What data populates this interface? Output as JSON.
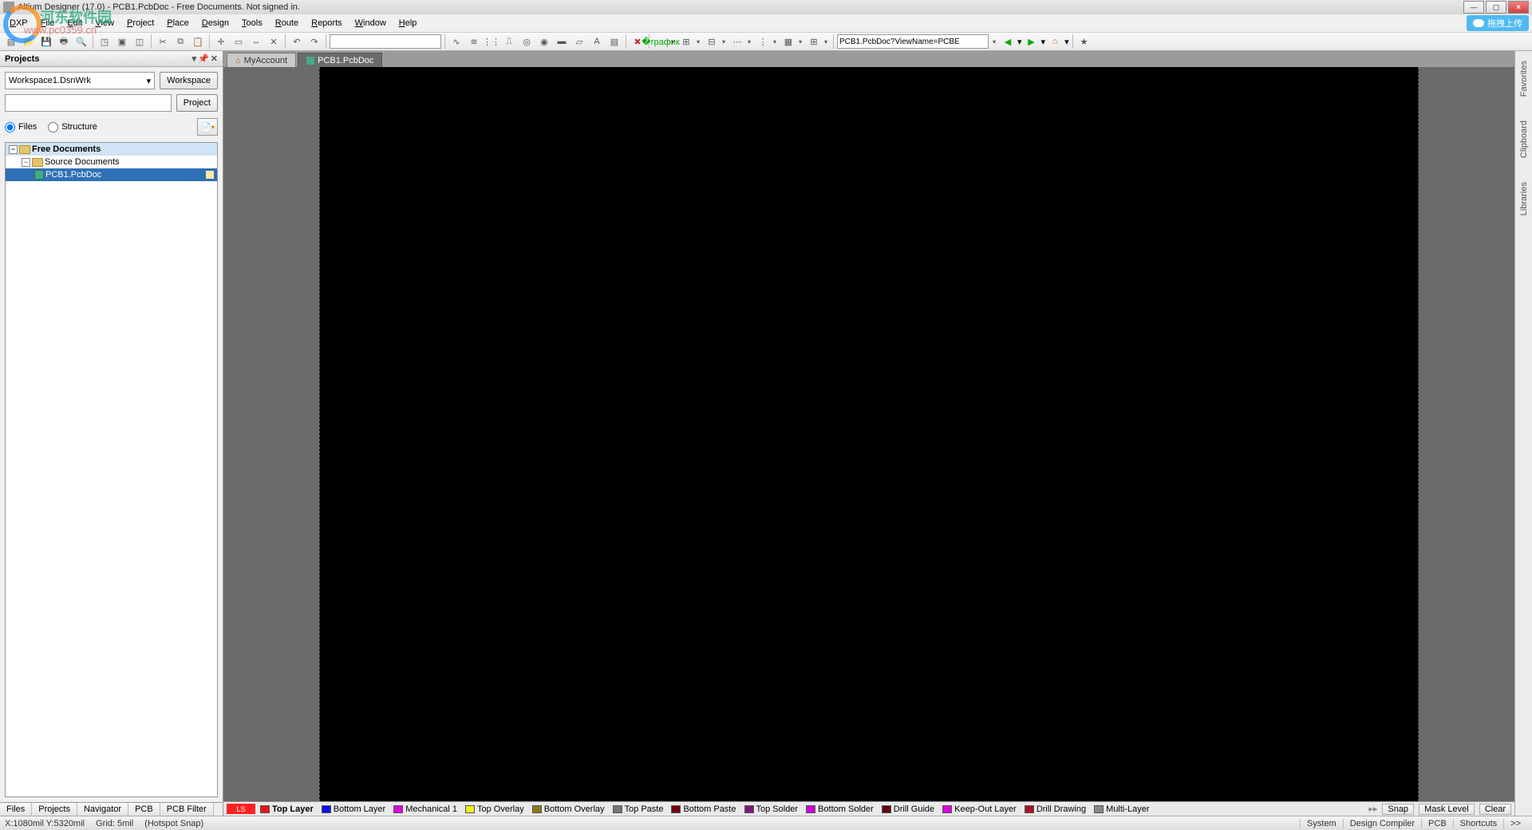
{
  "title": "Altium Designer (17.0) - PCB1.PcbDoc - Free Documents. Not signed in.",
  "watermark": {
    "line1": "河东软件园",
    "line2": "www.pc0359.cn"
  },
  "menu": {
    "items": [
      {
        "pre": "D",
        "post": "XP"
      },
      {
        "pre": "F",
        "post": "ile"
      },
      {
        "pre": "E",
        "post": "dit"
      },
      {
        "pre": "V",
        "post": "iew"
      },
      {
        "pre": "P",
        "post": "roject"
      },
      {
        "pre": "P",
        "post": "lace"
      },
      {
        "pre": "D",
        "post": "esign"
      },
      {
        "pre": "T",
        "post": "ools"
      },
      {
        "pre": "R",
        "post": "oute"
      },
      {
        "pre": "R",
        "post": "eports"
      },
      {
        "pre": "W",
        "post": "indow"
      },
      {
        "pre": "H",
        "post": "elp"
      }
    ],
    "right_button": "拖拽上传"
  },
  "toolbar": {
    "nav_field": "PCB1.PcbDoc?ViewName=PCBE"
  },
  "projects": {
    "title": "Projects",
    "workspace_select": "Workspace1.DsnWrk",
    "workspace_btn": "Workspace",
    "project_btn": "Project",
    "radio_files": "Files",
    "radio_structure": "Structure",
    "tree": {
      "root": "Free Documents",
      "folder": "Source Documents",
      "doc": "PCB1.PcbDoc"
    },
    "bottom_tabs": [
      "Files",
      "Projects",
      "Navigator",
      "PCB",
      "PCB Filter"
    ]
  },
  "doc_tabs": [
    {
      "label": "MyAccount",
      "active": false,
      "home": true
    },
    {
      "label": "PCB1.PcbDoc",
      "active": true,
      "home": false
    }
  ],
  "right_rail": [
    "Favorites",
    "Clipboard",
    "Libraries"
  ],
  "layers": {
    "ls": "LS",
    "items": [
      {
        "name": "Top Layer",
        "color": "#e11",
        "active": true
      },
      {
        "name": "Bottom Layer",
        "color": "#11e",
        "active": false
      },
      {
        "name": "Mechanical 1",
        "color": "#d0d",
        "active": false
      },
      {
        "name": "Top Overlay",
        "color": "#ee2",
        "active": false
      },
      {
        "name": "Bottom Overlay",
        "color": "#8a7a1a",
        "active": false
      },
      {
        "name": "Top Paste",
        "color": "#777",
        "active": false
      },
      {
        "name": "Bottom Paste",
        "color": "#701",
        "active": false
      },
      {
        "name": "Top Solder",
        "color": "#7a1a7a",
        "active": false
      },
      {
        "name": "Bottom Solder",
        "color": "#c0d",
        "active": false
      },
      {
        "name": "Drill Guide",
        "color": "#601",
        "active": false
      },
      {
        "name": "Keep-Out Layer",
        "color": "#d0d",
        "active": false
      },
      {
        "name": "Drill Drawing",
        "color": "#a12",
        "active": false
      },
      {
        "name": "Multi-Layer",
        "color": "#888",
        "active": false
      }
    ],
    "right_buttons": [
      "Snap",
      "Mask Level",
      "Clear"
    ]
  },
  "status": {
    "coords": "X:1080mil Y:5320mil",
    "grid": "Grid: 5mil",
    "snap": "(Hotspot Snap)",
    "right": [
      "System",
      "Design Compiler",
      "PCB",
      "Shortcuts",
      ">>"
    ]
  }
}
